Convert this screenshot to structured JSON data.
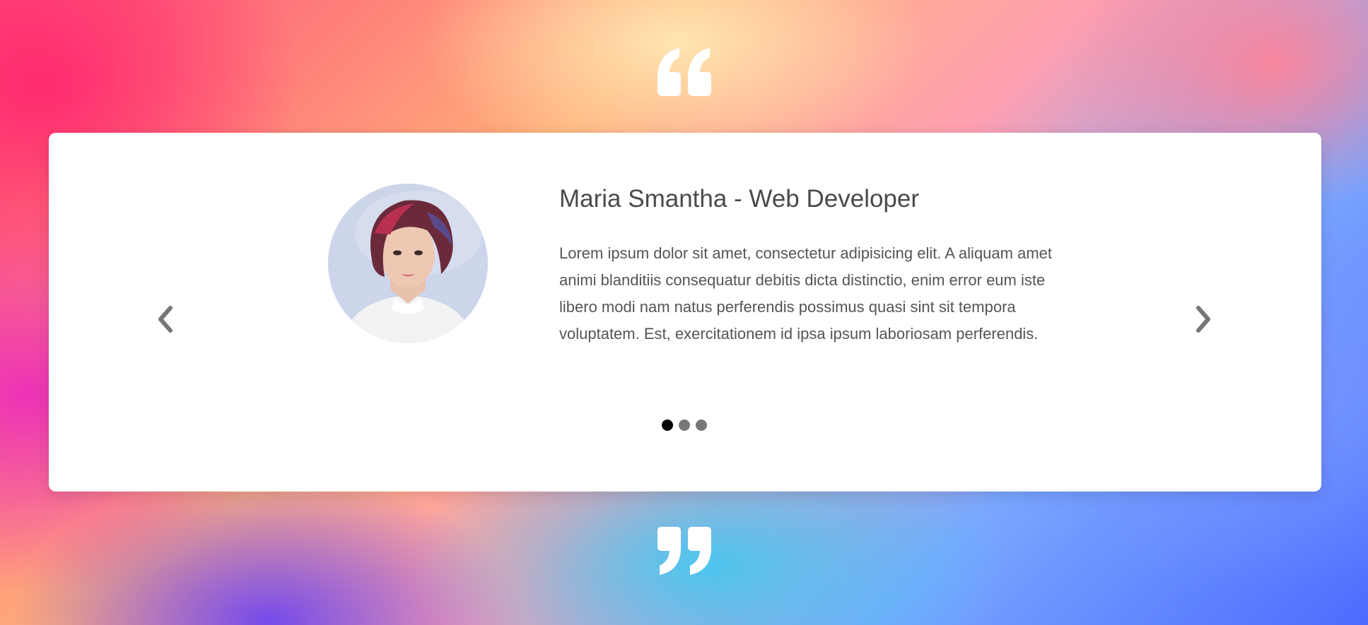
{
  "testimonial": {
    "name_title": "Maria Smantha - Web Developer",
    "quote": "Lorem ipsum dolor sit amet, consectetur adipisicing elit. A aliquam amet animi blanditiis consequatur debitis dicta distinctio, enim error eum iste libero modi nam natus perferendis possimus quasi sint sit tempora voluptatem. Est, exercitationem id ipsa ipsum laboriosam perferendis."
  },
  "carousel": {
    "slide_count": 3,
    "active_index": 0
  },
  "icons": {
    "open_quote": "quote-open-icon",
    "close_quote": "quote-close-icon",
    "prev": "chevron-left-icon",
    "next": "chevron-right-icon"
  },
  "colors": {
    "card_background": "#ffffff",
    "heading_text": "#4a4a4a",
    "body_text": "#555555",
    "arrow": "#777777",
    "dot_inactive": "#777777",
    "dot_active": "#000000"
  }
}
